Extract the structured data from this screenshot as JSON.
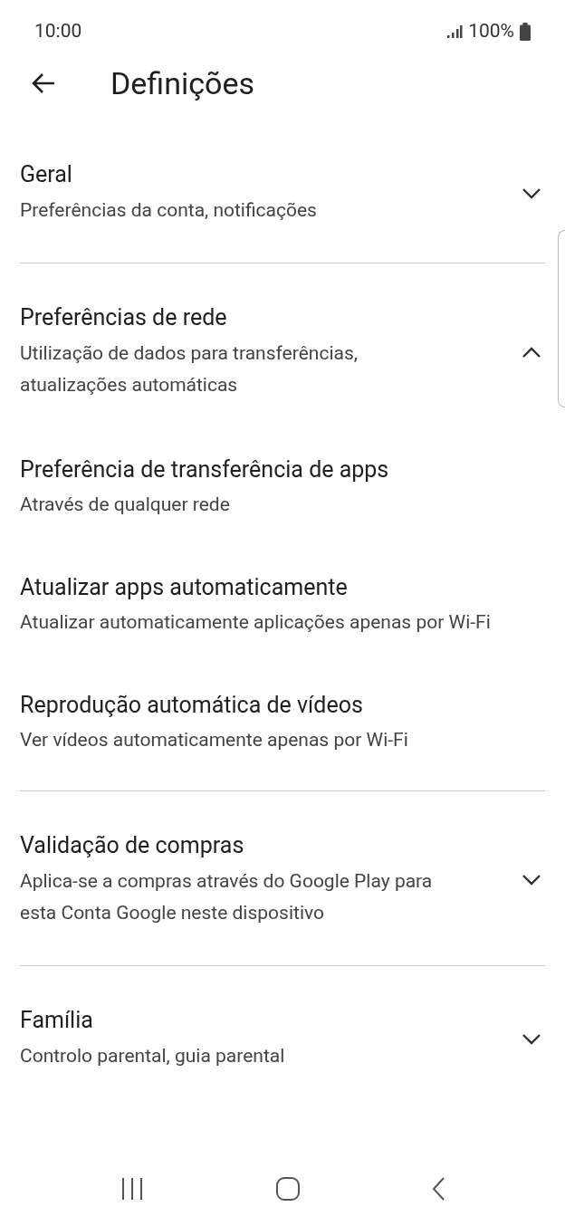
{
  "status_bar": {
    "time": "10:00",
    "battery": "100%"
  },
  "header": {
    "title": "Definições"
  },
  "sections": [
    {
      "title": "Geral",
      "subtitle": "Preferências da conta, notificações",
      "expanded": false
    },
    {
      "title": "Preferências de rede",
      "subtitle": "Utilização de dados para transferências, atualizações automáticas",
      "expanded": true,
      "children": [
        {
          "title": "Preferência de transferência de apps",
          "subtitle": "Através de qualquer rede"
        },
        {
          "title": "Atualizar apps automaticamente",
          "subtitle": "Atualizar automaticamente aplicações apenas por Wi-Fi"
        },
        {
          "title": "Reprodução automática de vídeos",
          "subtitle": "Ver vídeos automaticamente apenas por Wi-Fi"
        }
      ]
    },
    {
      "title": "Validação de compras",
      "subtitle": "Aplica-se a compras através do Google Play para esta Conta Google neste dispositivo",
      "expanded": false
    },
    {
      "title": "Família",
      "subtitle": "Controlo parental, guia parental",
      "expanded": false
    }
  ]
}
